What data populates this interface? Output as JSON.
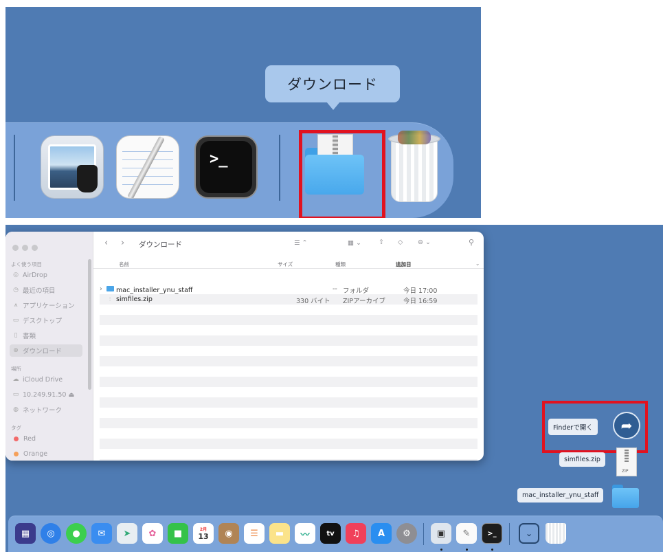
{
  "top_panel": {
    "tooltip": "ダウンロード",
    "dock_items": [
      "preview-icon",
      "textedit-icon",
      "terminal-icon",
      "downloads-folder-icon",
      "trash-icon"
    ],
    "terminal_prompt": ">_"
  },
  "finder": {
    "window_title": "ダウンロード",
    "sidebar": {
      "favorites_header": "よく使う項目",
      "favorites": [
        {
          "label": "AirDrop",
          "icon": "airdrop-icon"
        },
        {
          "label": "最近の項目",
          "icon": "clock-icon"
        },
        {
          "label": "アプリケーション",
          "icon": "apps-icon"
        },
        {
          "label": "デスクトップ",
          "icon": "desktop-icon"
        },
        {
          "label": "書類",
          "icon": "document-icon"
        },
        {
          "label": "ダウンロード",
          "icon": "download-icon",
          "selected": true
        }
      ],
      "locations_header": "場所",
      "locations": [
        {
          "label": "iCloud Drive",
          "icon": "cloud-icon"
        },
        {
          "label": "10.249.91.50 ⏏",
          "icon": "monitor-icon"
        },
        {
          "label": "ネットワーク",
          "icon": "globe-icon"
        }
      ],
      "tags_header": "タグ",
      "tags": [
        {
          "label": "Red",
          "color": "#f26a6a"
        },
        {
          "label": "Orange",
          "color": "#f5a05a"
        }
      ]
    },
    "columns": {
      "name": "名前",
      "size": "サイズ",
      "kind": "種類",
      "date_added": "追加日"
    },
    "files": [
      {
        "name": "mac_installer_ynu_staff",
        "size": "--",
        "kind": "フォルダ",
        "date": "今日 17:00",
        "type": "folder"
      },
      {
        "name": "simfiles.zip",
        "size": "330 バイト",
        "kind": "ZIPアーカイブ",
        "date": "今日 16:59",
        "type": "zip"
      }
    ]
  },
  "desktop": {
    "open_in_finder": "Finderで開く",
    "zip_label": "simfiles.zip",
    "zip_tag": "ZIP",
    "folder_label": "mac_installer_ynu_staff"
  },
  "dock": {
    "calendar_month": "2月",
    "calendar_day": "13",
    "tv_label": "tv"
  }
}
